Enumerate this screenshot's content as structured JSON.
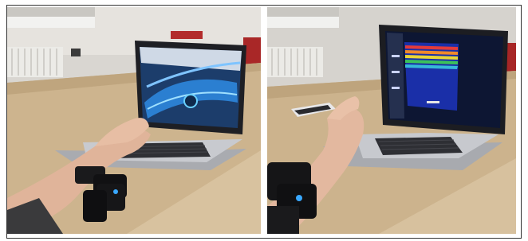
{
  "figure": {
    "panels": [
      {
        "id": "left",
        "scene": "racing-game"
      },
      {
        "id": "right",
        "scene": "breakout-game"
      }
    ],
    "screen_text": {
      "left_hud": "",
      "right_hud": ""
    }
  }
}
